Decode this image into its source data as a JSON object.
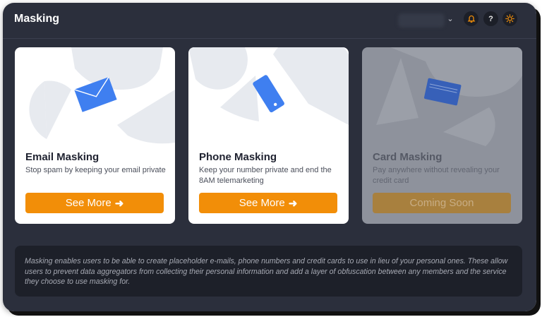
{
  "header": {
    "title": "Masking",
    "icons": [
      "chevron-down-icon",
      "bell-icon",
      "help-icon",
      "sun-icon"
    ],
    "help_label": "?"
  },
  "cards": [
    {
      "title": "Email Masking",
      "description": "Stop spam by keeping your email private",
      "button": "See More",
      "icon": "envelope-icon"
    },
    {
      "title": "Phone Masking",
      "description": "Keep your number private and end the 8AM telemarketing",
      "button": "See More",
      "icon": "phone-icon"
    },
    {
      "title": "Card Masking",
      "description": "Pay anywhere without revealing your credit card",
      "button": "Coming Soon",
      "icon": "credit-card-icon"
    }
  ],
  "info": {
    "text": "Masking enables users to be able to create placeholder e-mails, phone numbers and credit cards to use in lieu of your personal ones. These allow users to prevent data aggregators from collecting their personal information and add a layer of obfuscation between any members and the service they choose to use masking for."
  },
  "colors": {
    "accent": "#f28e08",
    "background": "#2b2f3c",
    "info_panel": "#1d2029",
    "icon_blue": "#3f7ff0"
  }
}
